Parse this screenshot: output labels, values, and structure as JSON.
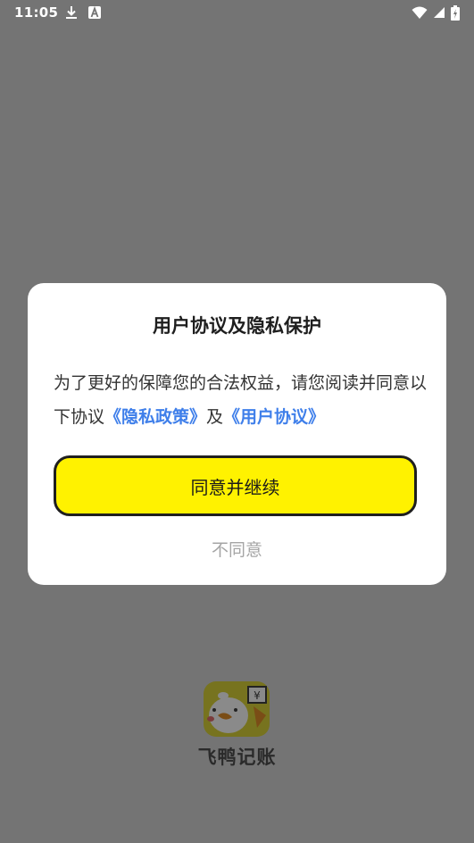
{
  "status_bar": {
    "time": "11:05",
    "icons_left": [
      "download-icon",
      "text-a-icon"
    ],
    "icons_right": [
      "wifi-icon",
      "signal-icon",
      "battery-icon"
    ]
  },
  "dialog": {
    "title": "用户协议及隐私保护",
    "message_part1": "为了更好的保障您的合法权益，请您阅读并同意以下协议",
    "privacy_link": "《隐私政策》",
    "connector": "及",
    "user_agreement_link": "《用户协议》",
    "agree_label": "同意并继续",
    "disagree_label": "不同意"
  },
  "app": {
    "name": "飞鸭记账",
    "logo_icon": "duck-logo-icon"
  },
  "colors": {
    "overlay": "#747474",
    "accent_yellow": "#fff200",
    "link_blue": "#3f7fea",
    "muted_gray": "#a5a5a5"
  }
}
